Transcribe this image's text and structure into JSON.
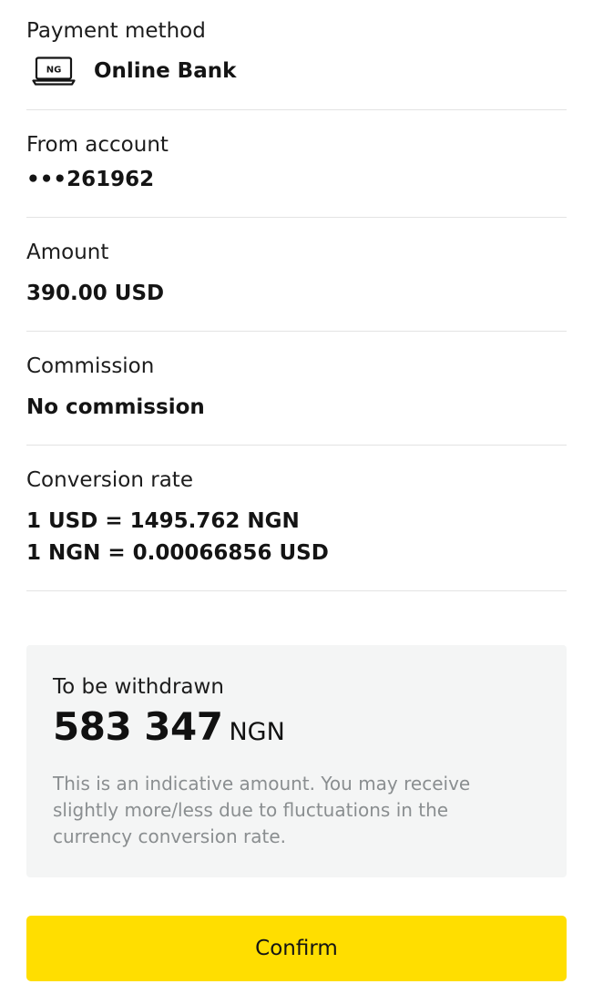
{
  "payment_method": {
    "label": "Payment method",
    "icon": "online-bank-laptop-icon",
    "icon_text": "NG",
    "value": "Online Bank"
  },
  "from_account": {
    "label": "From account",
    "value": "•••261962"
  },
  "amount": {
    "label": "Amount",
    "value": "390.00 USD"
  },
  "commission": {
    "label": "Commission",
    "value": "No commission"
  },
  "conversion_rate": {
    "label": "Conversion rate",
    "line1": "1 USD = 1495.762 NGN",
    "line2": "1 NGN = 0.00066856 USD"
  },
  "summary": {
    "label": "To be withdrawn",
    "amount": "583 347",
    "currency": "NGN",
    "disclaimer": "This is an indicative amount. You may receive slightly more/less due to fluctuations in the currency conversion rate."
  },
  "actions": {
    "confirm_label": "Confirm"
  },
  "colors": {
    "accent": "#ffde00",
    "card_background": "#f4f5f5",
    "divider": "#e3e3e3",
    "muted_text": "#8a8e90"
  }
}
